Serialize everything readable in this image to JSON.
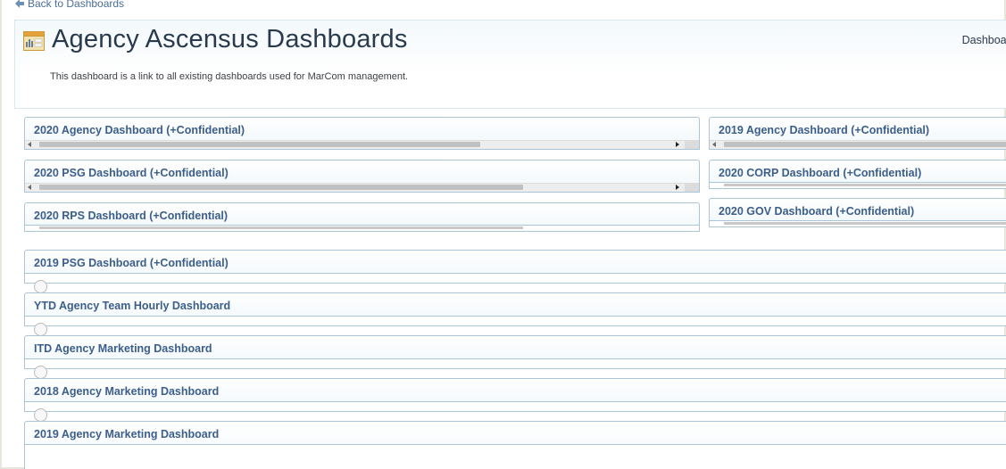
{
  "nav": {
    "back_label": "Back to Dashboards"
  },
  "header": {
    "title": "Agency Ascensus Dashboards",
    "right_label": "Dashboards",
    "description": "This dashboard is a link to all existing dashboards used for MarCom management."
  },
  "panels": {
    "left": [
      {
        "title": "2020 Agency Dashboard (+Confidential)"
      },
      {
        "title": "2020 PSG Dashboard (+Confidential)"
      },
      {
        "title": "2020 RPS Dashboard (+Confidential)"
      }
    ],
    "right": [
      {
        "title": "2019 Agency Dashboard (+Confidential)"
      },
      {
        "title": "2020 CORP Dashboard (+Confidential)"
      },
      {
        "title": "2020 GOV Dashboard (+Confidential)"
      }
    ],
    "full": [
      {
        "title": "2019 PSG Dashboard (+Confidential)"
      },
      {
        "title": "YTD Agency Team Hourly Dashboard"
      },
      {
        "title": "ITD Agency Marketing Dashboard"
      },
      {
        "title": "2018 Agency Marketing Dashboard"
      },
      {
        "title": "2019 Agency Marketing Dashboard"
      }
    ]
  },
  "colors": {
    "panel_title": "#3b5e8c",
    "panel_border": "#aac5d8",
    "page_title": "#2a3a4d",
    "link": "#4a6d9a"
  },
  "icons": {
    "header": "dashboard-chart-icon",
    "back": "back-arrow-icon"
  }
}
